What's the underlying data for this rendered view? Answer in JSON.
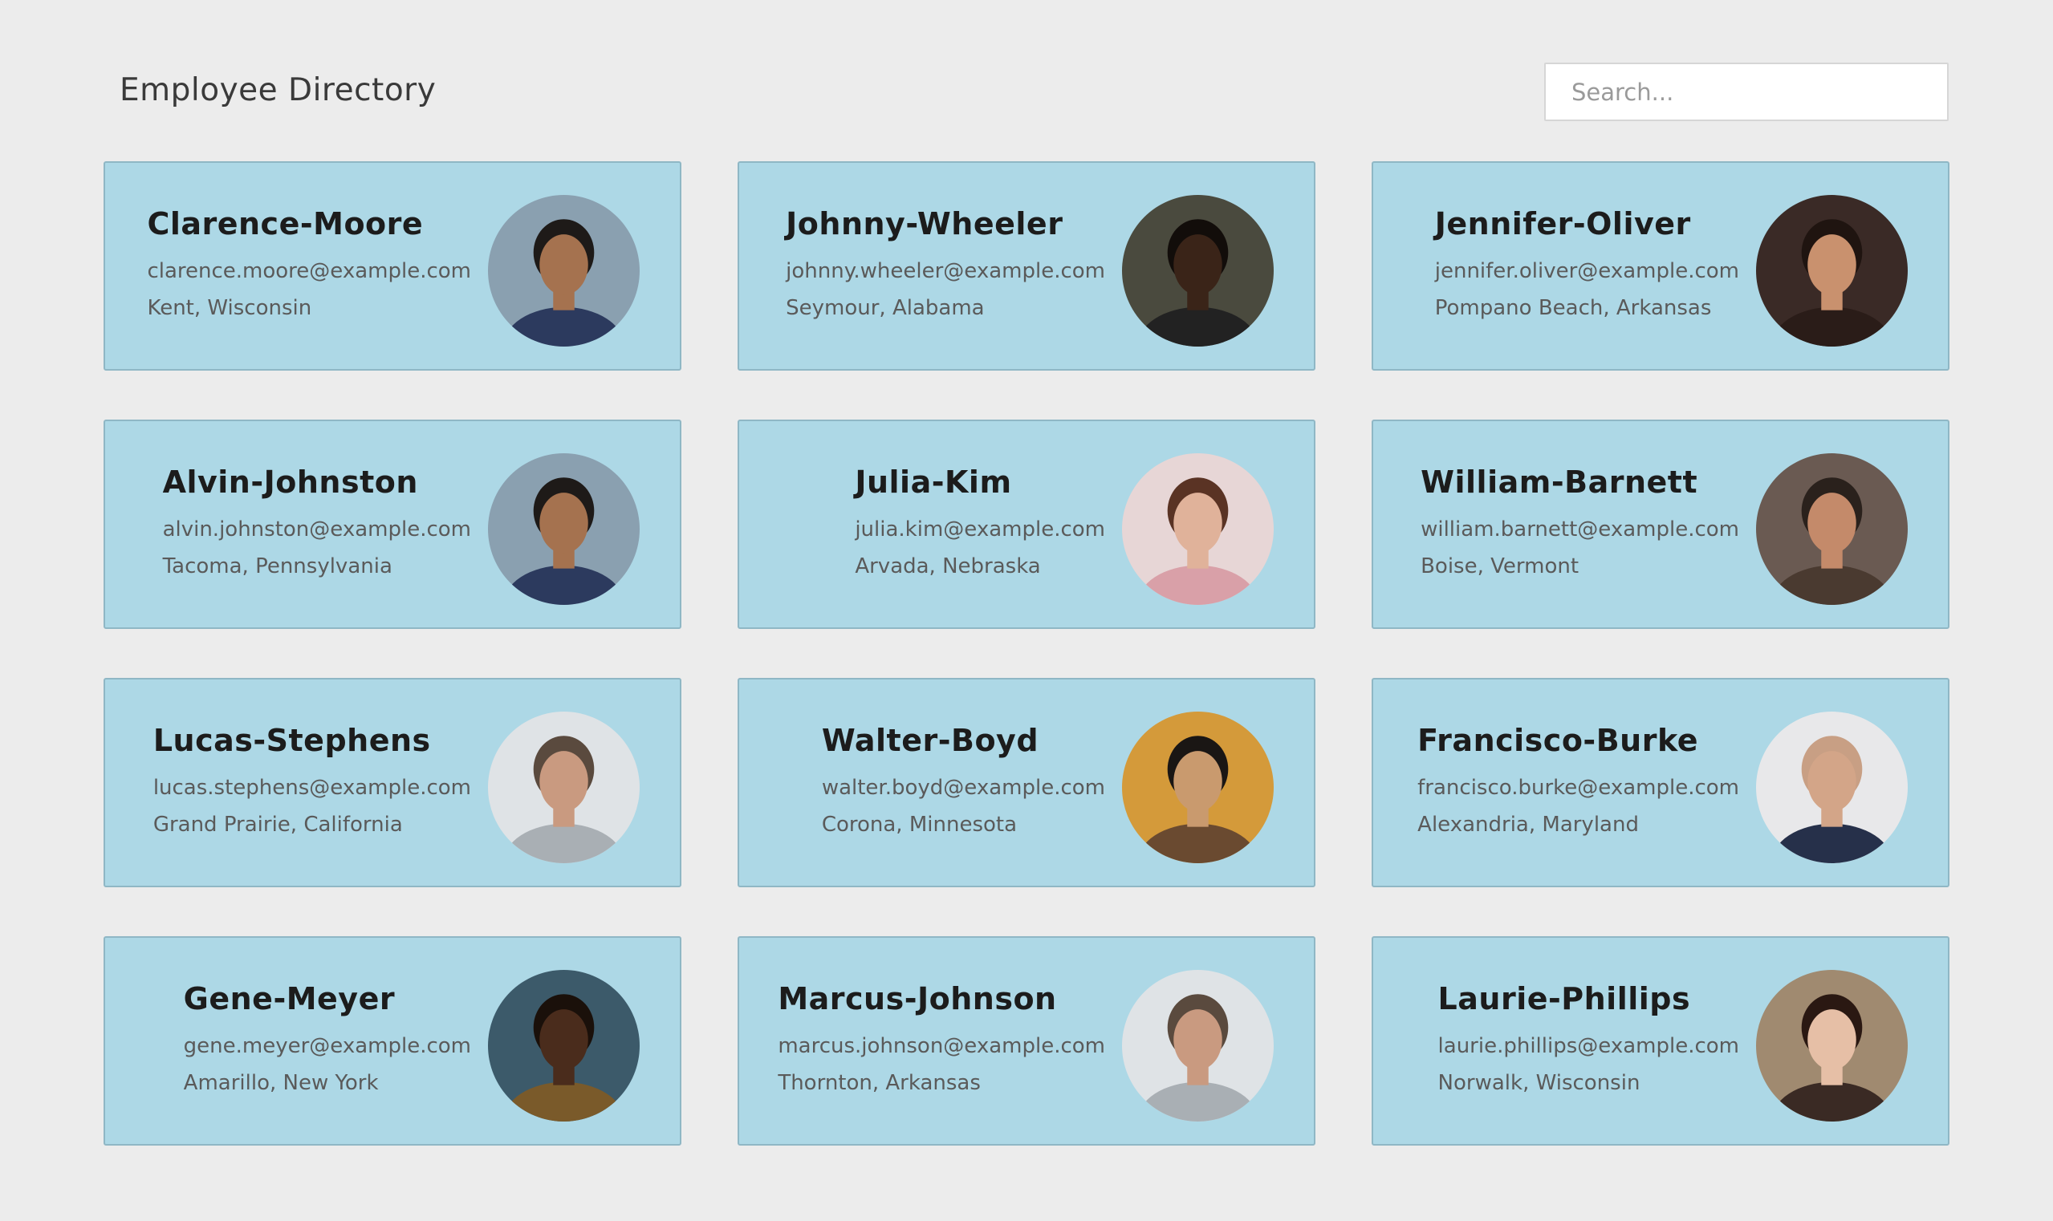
{
  "header": {
    "title": "Employee Directory",
    "search_placeholder": "Search..."
  },
  "employees": [
    {
      "name": "Clarence-Moore",
      "email": "clarence.moore@example.com",
      "location": "Kent, Wisconsin",
      "avatar": {
        "bg": "#8aa0b0",
        "skin": "#a5724f",
        "hair": "#1e1a18",
        "shirt": "#2c3a5e"
      }
    },
    {
      "name": "Johnny-Wheeler",
      "email": "johnny.wheeler@example.com",
      "location": "Seymour, Alabama",
      "avatar": {
        "bg": "#4a4a3e",
        "skin": "#3a2418",
        "hair": "#120d0a",
        "shirt": "#222222"
      }
    },
    {
      "name": "Jennifer-Oliver",
      "email": "jennifer.oliver@example.com",
      "location": "Pompano Beach, Arkansas",
      "avatar": {
        "bg": "#3a2a26",
        "skin": "#c9916e",
        "hair": "#1f1410",
        "shirt": "#2a1c18"
      }
    },
    {
      "name": "Alvin-Johnston",
      "email": "alvin.johnston@example.com",
      "location": "Tacoma, Pennsylvania",
      "avatar": {
        "bg": "#8aa0b0",
        "skin": "#a5724f",
        "hair": "#1e1a18",
        "shirt": "#2c3a5e"
      }
    },
    {
      "name": "Julia-Kim",
      "email": "julia.kim@example.com",
      "location": "Arvada, Nebraska",
      "avatar": {
        "bg": "#e7d6d6",
        "skin": "#e0b29a",
        "hair": "#5a3324",
        "shirt": "#d9a0a8"
      }
    },
    {
      "name": "William-Barnett",
      "email": "william.barnett@example.com",
      "location": "Boise, Vermont",
      "avatar": {
        "bg": "#6a5a52",
        "skin": "#c48a6a",
        "hair": "#2a211c",
        "shirt": "#4a3a30"
      }
    },
    {
      "name": "Lucas-Stephens",
      "email": "lucas.stephens@example.com",
      "location": "Grand Prairie, California",
      "avatar": {
        "bg": "#dfe3e6",
        "skin": "#c99a80",
        "hair": "#5a4a3e",
        "shirt": "#a9afb4"
      }
    },
    {
      "name": "Walter-Boyd",
      "email": "walter.boyd@example.com",
      "location": "Corona, Minnesota",
      "avatar": {
        "bg": "#d49a3a",
        "skin": "#c99a6e",
        "hair": "#1a1614",
        "shirt": "#6a4a30"
      }
    },
    {
      "name": "Francisco-Burke",
      "email": "francisco.burke@example.com",
      "location": "Alexandria, Maryland",
      "avatar": {
        "bg": "#e8e8ea",
        "skin": "#d3a588",
        "hair": "#c89f84",
        "shirt": "#26304a"
      }
    },
    {
      "name": "Gene-Meyer",
      "email": "gene.meyer@example.com",
      "location": "Amarillo, New York",
      "avatar": {
        "bg": "#3c5a6a",
        "skin": "#4a2c1c",
        "hair": "#1a100a",
        "shirt": "#7a5a2a"
      }
    },
    {
      "name": "Marcus-Johnson",
      "email": "marcus.johnson@example.com",
      "location": "Thornton, Arkansas",
      "avatar": {
        "bg": "#dfe3e6",
        "skin": "#c99a80",
        "hair": "#5a4a3e",
        "shirt": "#a9afb4"
      }
    },
    {
      "name": "Laurie-Phillips",
      "email": "laurie.phillips@example.com",
      "location": "Norwalk, Wisconsin",
      "avatar": {
        "bg": "#a08a70",
        "skin": "#e6bfa6",
        "hair": "#2a1812",
        "shirt": "#3a2a24"
      }
    }
  ]
}
